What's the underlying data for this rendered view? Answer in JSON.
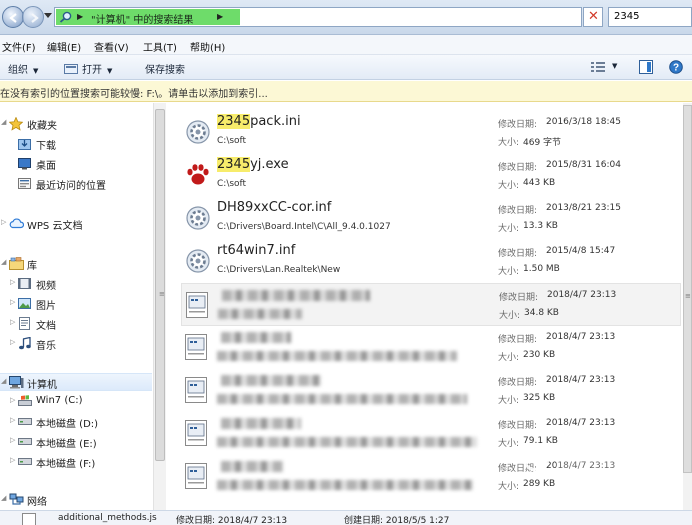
{
  "window": {
    "breadcrumb_text": "\"计算机\" 中的搜索结果",
    "search_query": "2345",
    "search_fill_color": "#6edc6a"
  },
  "menu": {
    "file": "文件(F)",
    "edit": "编辑(E)",
    "view": "查看(V)",
    "tools": "工具(T)",
    "help": "帮助(H)"
  },
  "toolbar": {
    "organize": "组织",
    "open": "打开",
    "save_search": "保存搜索"
  },
  "infobar": {
    "text": "在没有索引的位置搜索可能较慢: F:\\。请单击以添加到索引..."
  },
  "sidebar": {
    "favorites": "收藏夹",
    "downloads": "下载",
    "desktop": "桌面",
    "recent": "最近访问的位置",
    "wps": "WPS 云文档",
    "libraries": "库",
    "videos": "视频",
    "pictures": "图片",
    "documents": "文档",
    "music": "音乐",
    "computer": "计算机",
    "drive_c": "Win7 (C:)",
    "drive_d": "本地磁盘 (D:)",
    "drive_e": "本地磁盘 (E:)",
    "drive_f": "本地磁盘 (F:)",
    "network": "网络"
  },
  "results": {
    "modified_label": "修改日期:",
    "size_label": "大小:",
    "items": [
      {
        "name_hit": "2345",
        "name_rest": "pack.ini",
        "path": "C:\\soft",
        "modified": "2016/3/18 18:45",
        "size": "469 字节",
        "icon": "settings-file-icon"
      },
      {
        "name_hit": "2345",
        "name_rest": "yj.exe",
        "path": "C:\\soft",
        "modified": "2015/8/31 16:04",
        "size": "443 KB",
        "icon": "paw-app-icon"
      },
      {
        "name_hit": "",
        "name_rest": "DH89xxCC-cor.inf",
        "path": "C:\\Drivers\\Board.Intel\\C\\All_9.4.0.1027",
        "modified": "2013/8/21 23:15",
        "size": "13.3 KB",
        "icon": "settings-file-icon"
      },
      {
        "name_hit": "",
        "name_rest": "rt64win7.inf",
        "path": "C:\\Drivers\\Lan.Realtek\\New",
        "modified": "2015/4/8 15:47",
        "size": "1.50 MB",
        "icon": "settings-file-icon"
      },
      {
        "name_hit": "",
        "name_rest": "",
        "path": "",
        "modified": "2018/4/7 23:13",
        "size": "34.8 KB",
        "icon": "script-file-icon"
      },
      {
        "name_hit": "",
        "name_rest": "",
        "path": "",
        "modified": "2018/4/7 23:13",
        "size": "230 KB",
        "icon": "script-file-icon"
      },
      {
        "name_hit": "",
        "name_rest": "",
        "path": "",
        "modified": "2018/4/7 23:13",
        "size": "325 KB",
        "icon": "script-file-icon"
      },
      {
        "name_hit": "",
        "name_rest": "",
        "path": "",
        "modified": "2018/4/7 23:13",
        "size": "79.1 KB",
        "icon": "script-file-icon"
      },
      {
        "name_hit": "",
        "name_rest": "",
        "path": "",
        "modified": "2018/4/7 23:13",
        "size": "289 KB",
        "icon": "script-file-icon"
      }
    ]
  },
  "details": {
    "filename": "additional_methods.js",
    "modified": "修改日期: 2018/4/7 23:13",
    "created": "创建日期: 2018/5/5 1:27"
  }
}
